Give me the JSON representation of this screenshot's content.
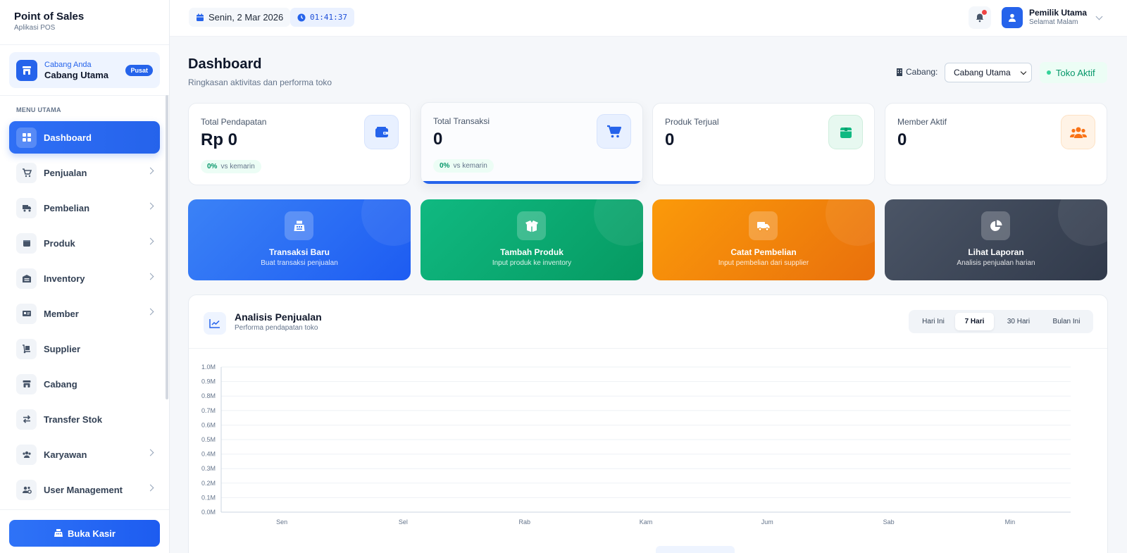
{
  "brand": {
    "title": "Point of Sales",
    "subtitle": "Aplikasi POS"
  },
  "branch_card": {
    "label": "Cabang Anda",
    "name": "Cabang Utama",
    "badge": "Pusat"
  },
  "sidebar": {
    "heading": "MENU UTAMA",
    "items": [
      {
        "label": "Dashboard",
        "icon": "grid-icon"
      },
      {
        "label": "Penjualan",
        "icon": "cart-icon"
      },
      {
        "label": "Pembelian",
        "icon": "truck-icon"
      },
      {
        "label": "Produk",
        "icon": "box-icon"
      },
      {
        "label": "Inventory",
        "icon": "warehouse-icon"
      },
      {
        "label": "Member",
        "icon": "id-card-icon"
      },
      {
        "label": "Supplier",
        "icon": "dolly-icon"
      },
      {
        "label": "Cabang",
        "icon": "store-icon"
      },
      {
        "label": "Transfer Stok",
        "icon": "transfer-icon"
      },
      {
        "label": "Karyawan",
        "icon": "users-icon"
      },
      {
        "label": "User Management",
        "icon": "users-cog-icon"
      }
    ],
    "kasir_button": "Buka Kasir"
  },
  "topbar": {
    "date": "Senin, 2 Mar 2026",
    "time": "01:41:37",
    "user_name": "Pemilik Utama",
    "user_greeting": "Selamat Malam"
  },
  "page": {
    "title": "Dashboard",
    "subtitle": "Ringkasan aktivitas dan performa toko",
    "cabang_label": "Cabang:",
    "cabang_selected": "Cabang Utama",
    "status": "Toko Aktif"
  },
  "stats": [
    {
      "label": "Total Pendapatan",
      "value": "Rp 0",
      "trend_value": "0%",
      "trend_text": "vs kemarin",
      "color": "#2563eb"
    },
    {
      "label": "Total Transaksi",
      "value": "0",
      "trend_value": "0%",
      "trend_text": "vs kemarin",
      "color": "#2563eb"
    },
    {
      "label": "Produk Terjual",
      "value": "0",
      "color": "#10b981"
    },
    {
      "label": "Member Aktif",
      "value": "0",
      "color": "#f97316"
    }
  ],
  "actions": [
    {
      "title": "Transaksi Baru",
      "subtitle": "Buat transaksi penjualan"
    },
    {
      "title": "Tambah Produk",
      "subtitle": "Input produk ke inventory"
    },
    {
      "title": "Catat Pembelian",
      "subtitle": "Input pembelian dari supplier"
    },
    {
      "title": "Lihat Laporan",
      "subtitle": "Analisis penjualan harian"
    }
  ],
  "analysis": {
    "title": "Analisis Penjualan",
    "subtitle": "Performa pendapatan toko",
    "tabs": [
      "Hari Ini",
      "7 Hari",
      "30 Hari",
      "Bulan Ini"
    ],
    "active_tab": "7 Hari"
  },
  "chart_data": {
    "type": "line",
    "categories": [
      "Sen",
      "Sel",
      "Rab",
      "Kam",
      "Jum",
      "Sab",
      "Min"
    ],
    "values": [
      0,
      0,
      0,
      0,
      0,
      0,
      0
    ],
    "yticks": [
      "0.0M",
      "0.1M",
      "0.2M",
      "0.3M",
      "0.4M",
      "0.5M",
      "0.6M",
      "0.7M",
      "0.8M",
      "0.9M",
      "1.0M"
    ],
    "ylim": [
      0,
      1000000
    ],
    "grid": true
  }
}
